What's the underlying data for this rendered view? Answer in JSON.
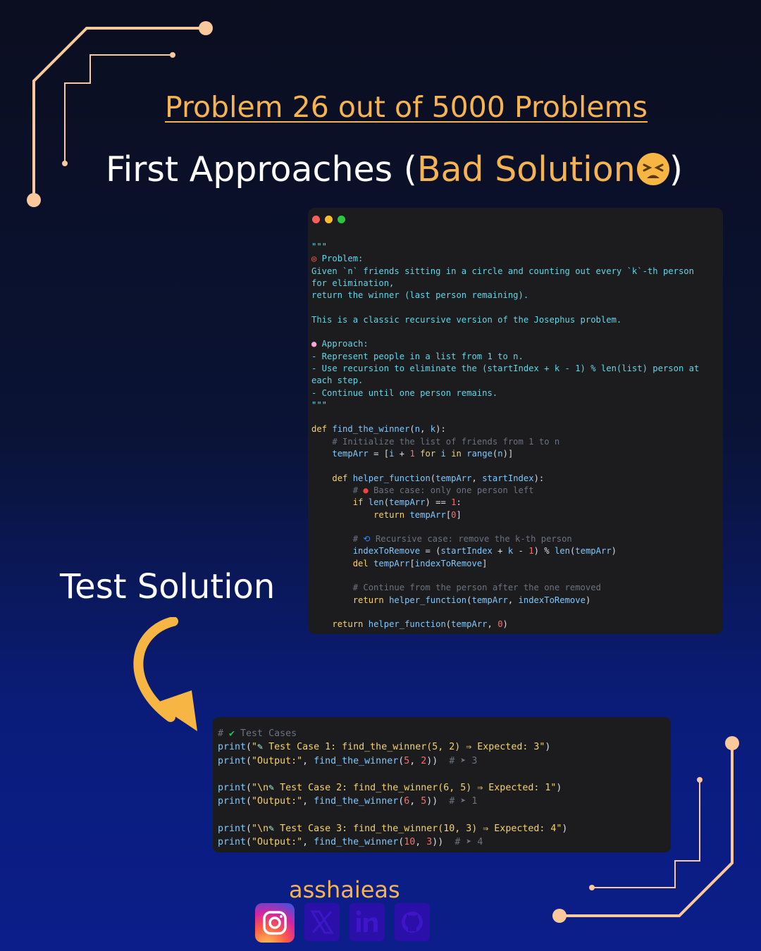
{
  "header": {
    "problem_title": "Problem 26 out of 5000 Problems",
    "approach_prefix": "First Approaches (",
    "approach_accent": "Bad Solution",
    "approach_suffix": ")",
    "emoji_icon": "tired-face-emoji"
  },
  "code_window": {
    "dot_colors": [
      "#ff5f56",
      "#ffbd2e",
      "#27c93f"
    ],
    "docstring": {
      "open": "\"\"\"",
      "problem_heading": " Problem:",
      "problem_line_1": "Given `n` friends sitting in a circle and counting out every `k`-th person",
      "problem_line_2": "for elimination,",
      "problem_line_3": "return the winner (last person remaining).",
      "classic_line": "This is a classic recursive version of the Josephus problem.",
      "approach_heading": " Approach:",
      "approach_1": "- Represent people in a list from 1 to n.",
      "approach_2": "- Use recursion to eliminate the (startIndex + k - 1) % len(list) person at",
      "approach_2b": "each step.",
      "approach_3": "- Continue until one person remains.",
      "close": "\"\"\""
    },
    "comments": {
      "init": "# Initialize the list of friends from 1 to n",
      "base_case": " Base case: only one person left",
      "recursive_case": " Recursive case: remove the k-th person",
      "continue": "# Continue from the person after the one removed"
    }
  },
  "test_section": {
    "label": "Test Solution",
    "comment": " Test Cases",
    "cases": [
      {
        "text": " Test Case 1: find_the_winner(5, 2) ⇒ Expected: 3",
        "n": "5",
        "k": "2",
        "result": "3",
        "prefix": ""
      },
      {
        "text": " Test Case 2: find_the_winner(6, 5) ⇒ Expected: 1",
        "n": "6",
        "k": "5",
        "result": "1",
        "prefix": "\\n"
      },
      {
        "text": " Test Case 3: find_the_winner(10, 3) ⇒ Expected: 4",
        "n": "10",
        "k": "3",
        "result": "4",
        "prefix": "\\n"
      }
    ],
    "output_label": "\"Output:\""
  },
  "footer": {
    "handle": "asshaieas",
    "socials": [
      "instagram-icon",
      "x-icon",
      "linkedin-icon",
      "github-icon"
    ]
  },
  "colors": {
    "accent": "#f6b352",
    "circuit": "#f9c89b"
  }
}
